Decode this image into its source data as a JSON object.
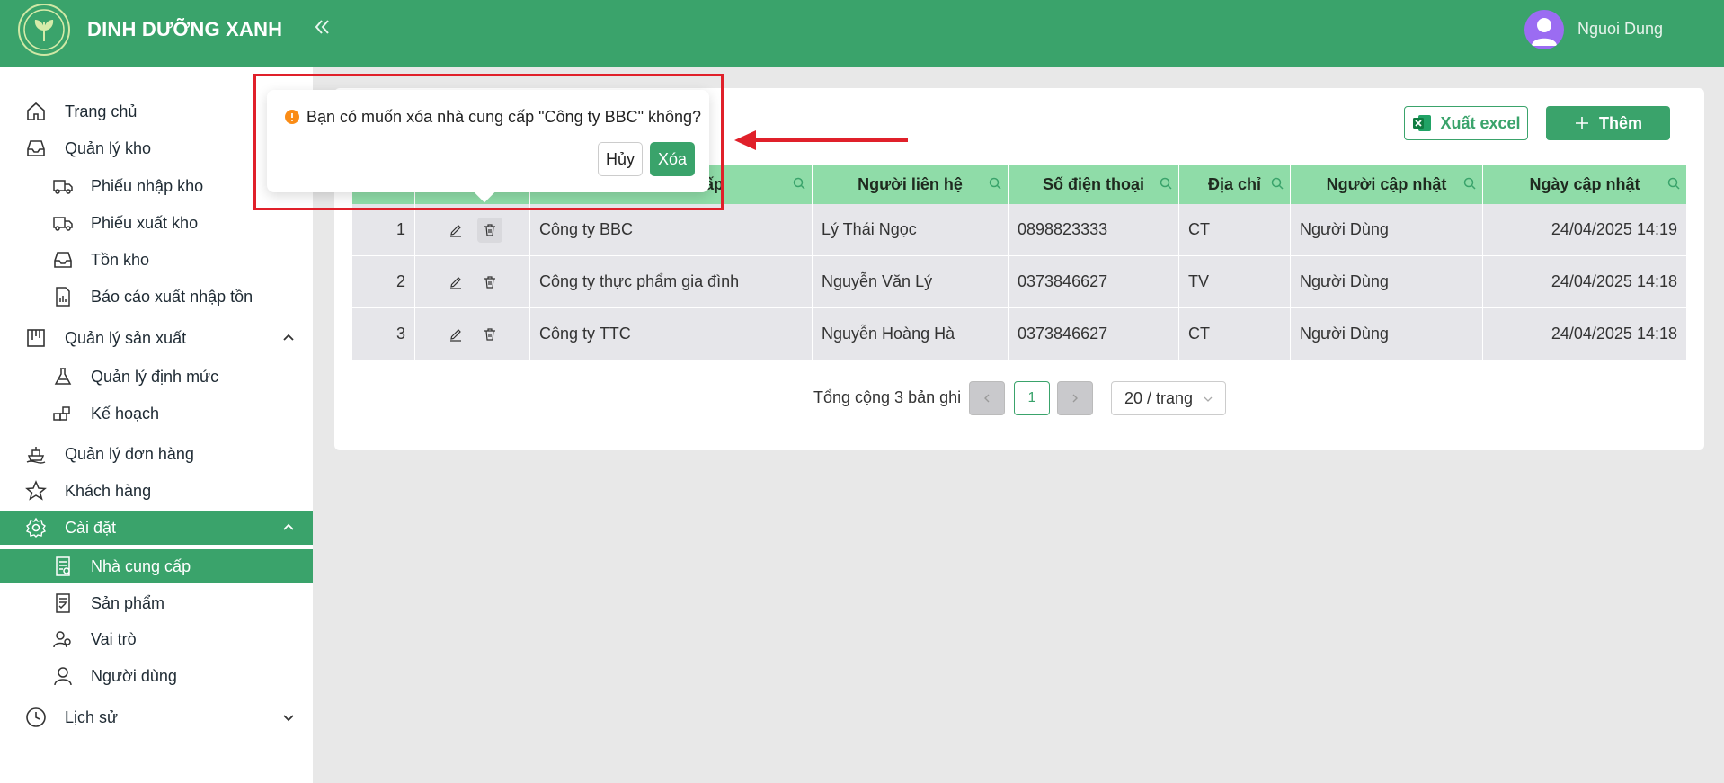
{
  "header": {
    "brand": "DINH DƯỠNG XANH",
    "collapse_icon": "double-chevron-left-icon",
    "user_name": "Nguoi Dung"
  },
  "sidebar": {
    "items": [
      {
        "label": "Trang chủ",
        "icon": "home-icon"
      },
      {
        "label": "Quản lý kho",
        "icon": "inbox-icon"
      },
      {
        "label": "Phiếu nhập kho",
        "icon": "truck-in-icon"
      },
      {
        "label": "Phiếu xuất kho",
        "icon": "truck-out-icon"
      },
      {
        "label": "Tồn kho",
        "icon": "inbox-icon"
      },
      {
        "label": "Báo cáo xuất nhập tồn",
        "icon": "report-icon"
      },
      {
        "label": "Quản lý sản xuất",
        "icon": "factory-icon"
      },
      {
        "label": "Quản lý định mức",
        "icon": "flask-icon"
      },
      {
        "label": "Kế hoạch",
        "icon": "blocks-icon"
      },
      {
        "label": "Quản lý đơn hàng",
        "icon": "ship-icon"
      },
      {
        "label": "Khách hàng",
        "icon": "star-icon"
      },
      {
        "label": "Cài đặt",
        "icon": "gear-icon"
      },
      {
        "label": "Nhà cung cấp",
        "icon": "supplier-icon"
      },
      {
        "label": "Sản phẩm",
        "icon": "product-icon"
      },
      {
        "label": "Vai trò",
        "icon": "team-icon"
      },
      {
        "label": "Người dùng",
        "icon": "user-icon"
      },
      {
        "label": "Lịch sử",
        "icon": "clock-icon"
      }
    ]
  },
  "toolbar": {
    "export_label": "Xuất excel",
    "add_label": "Thêm"
  },
  "table": {
    "columns": [
      "",
      "",
      "Tên nhà cung cấp",
      "Người liên hệ",
      "Số điện thoại",
      "Địa chỉ",
      "Người cập nhật",
      "Ngày cập nhật"
    ],
    "visible_header_fragment": "ấp",
    "rows": [
      {
        "stt": "1",
        "name": "Công ty BBC",
        "contact": "Lý Thái Ngọc",
        "phone": "0898823333",
        "address": "CT",
        "updated_by": "Người Dùng",
        "updated_at": "24/04/2025 14:19"
      },
      {
        "stt": "2",
        "name": "Công ty thực phẩm gia đình",
        "contact": "Nguyễn Văn Lý",
        "phone": "0373846627",
        "address": "TV",
        "updated_by": "Người Dùng",
        "updated_at": "24/04/2025 14:18"
      },
      {
        "stt": "3",
        "name": "Công ty TTC",
        "contact": "Nguyễn Hoàng Hà",
        "phone": "0373846627",
        "address": "CT",
        "updated_by": "Người Dùng",
        "updated_at": "24/04/2025 14:18"
      }
    ]
  },
  "pagination": {
    "total_text": "Tổng cộng 3 bản ghi",
    "current_page": "1",
    "page_size": "20 / trang"
  },
  "popconfirm": {
    "message": "Bạn có muốn xóa nhà cung cấp \"Công ty BBC\" không?",
    "cancel_label": "Hủy",
    "ok_label": "Xóa"
  },
  "colors": {
    "primary": "#3aa36b",
    "table_header": "#8fdca8",
    "highlight": "#e0202a",
    "warning": "#fa8c16"
  }
}
